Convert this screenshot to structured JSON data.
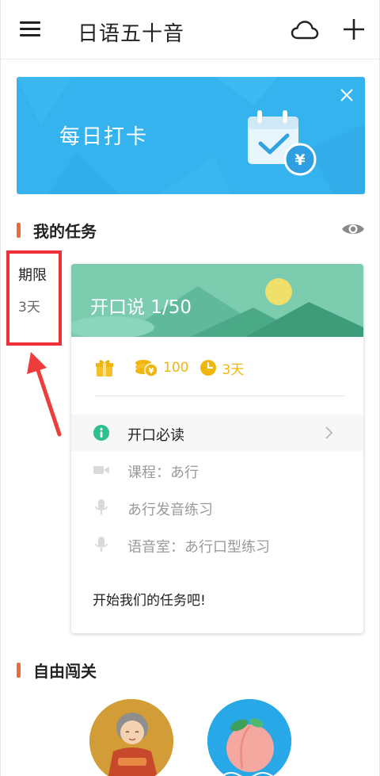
{
  "header": {
    "title": "日语五十音",
    "menu_icon": "menu-icon",
    "cloud_icon": "cloud-icon",
    "add_icon": "plus-icon"
  },
  "banner": {
    "text": "每日打卡",
    "close_icon": "close-icon",
    "art_icon": "calendar-check-yen-icon",
    "color": "#35b3ee"
  },
  "my_tasks": {
    "title": "我的任务",
    "visibility_icon": "eye-icon",
    "accent": "#ef6a3a"
  },
  "deadline": {
    "label": "期限",
    "value": "3天",
    "highlight_color": "#ee3138"
  },
  "task_card": {
    "title": "开口说 1/50",
    "rewards": [
      {
        "icon": "gift-icon",
        "value": ""
      },
      {
        "icon": "coins-icon",
        "value": "100"
      },
      {
        "icon": "clock-icon",
        "value": "3天"
      }
    ],
    "steps": [
      {
        "icon": "info-icon",
        "label": "开口必读"
      },
      {
        "icon": "video-camera-icon",
        "label": "课程：あ行"
      },
      {
        "icon": "microphone-icon",
        "label": "あ行发音练习"
      },
      {
        "icon": "microphone-icon",
        "label": "语音室：あ行口型练习"
      }
    ],
    "start_text": "开始我们的任务吧!",
    "reward_color": "#f0b60e"
  },
  "free_levels": {
    "title": "自由闯关",
    "items": [
      {
        "icon": "grandmother-avatar-icon"
      },
      {
        "icon": "peach-icon"
      }
    ]
  }
}
